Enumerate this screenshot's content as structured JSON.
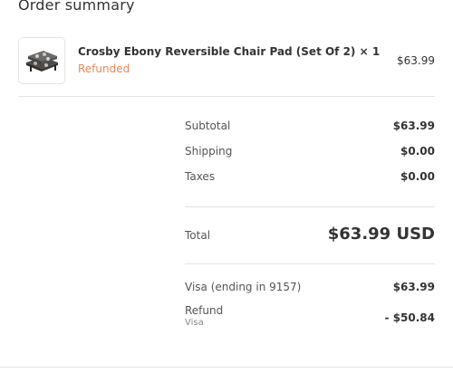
{
  "order_summary": {
    "title": "Order summary",
    "item": {
      "name": "Crosby Ebony Reversible Chair Pad (Set Of 2) × 1",
      "status": "Refunded",
      "price": "$63.99",
      "thumbnail_icon": "chair-pad-product-image"
    },
    "subtotal": {
      "label": "Subtotal",
      "value": "$63.99"
    },
    "shipping": {
      "label": "Shipping",
      "value": "$0.00"
    },
    "taxes": {
      "label": "Taxes",
      "value": "$0.00"
    },
    "total": {
      "label": "Total",
      "value": "$63.99 USD"
    },
    "payment": {
      "label": "Visa (ending in 9157)",
      "value": "$63.99"
    },
    "refund": {
      "label": "Refund",
      "method": "Visa",
      "value": "- $50.84"
    }
  },
  "colors": {
    "text": "#333333",
    "muted": "#555555",
    "refunded": "#e8885a",
    "divider": "#e3e3e3"
  }
}
